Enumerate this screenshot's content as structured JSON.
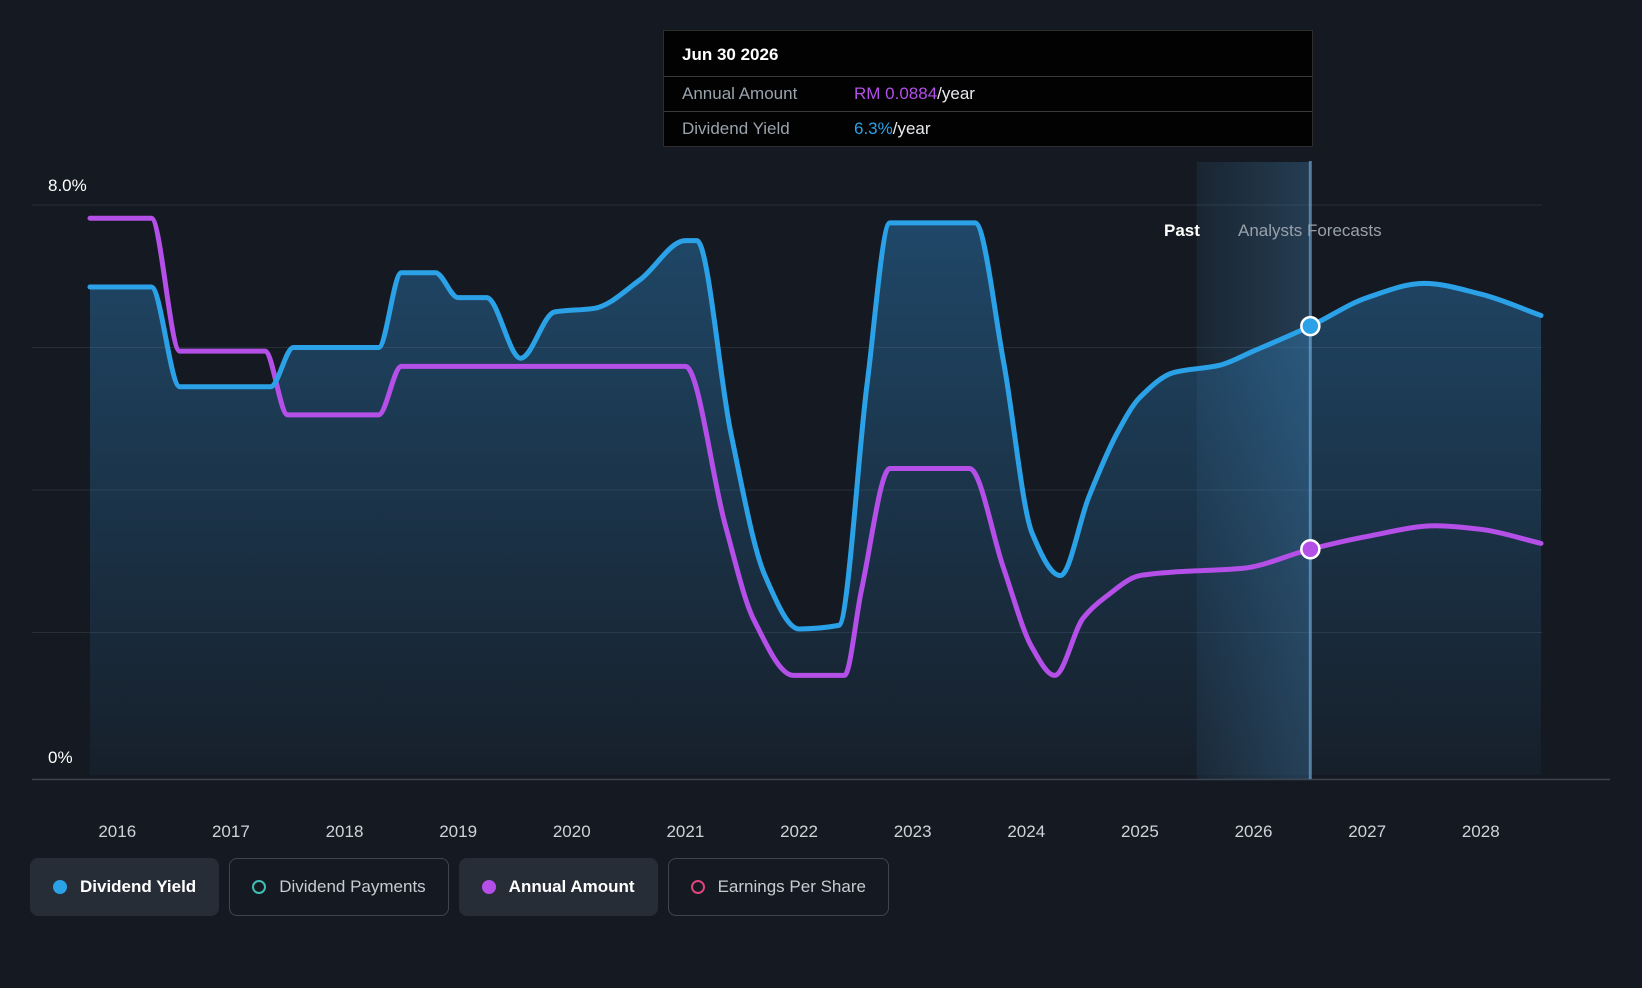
{
  "tooltip": {
    "date": "Jun 30 2026",
    "rows": [
      {
        "label": "Annual Amount",
        "value": "RM 0.0884",
        "suffix": "/year",
        "color": "#b44fe8"
      },
      {
        "label": "Dividend Yield",
        "value": "6.3%",
        "suffix": "/year",
        "color": "#2ba2e8"
      }
    ]
  },
  "legend": {
    "items": [
      {
        "label": "Dividend Yield",
        "color": "#2ba2e8",
        "marker": "filled",
        "active": true
      },
      {
        "label": "Dividend Payments",
        "color": "#3fbfb4",
        "marker": "outline",
        "active": false
      },
      {
        "label": "Annual Amount",
        "color": "#b44fe8",
        "marker": "filled",
        "active": true
      },
      {
        "label": "Earnings Per Share",
        "color": "#e0447e",
        "marker": "outline",
        "active": false
      }
    ]
  },
  "chart_data": {
    "type": "line",
    "x_unit": "year",
    "x_range": [
      2015.76,
      2028.53
    ],
    "x_ticks": [
      2016,
      2017,
      2018,
      2019,
      2020,
      2021,
      2022,
      2023,
      2024,
      2025,
      2026,
      2027,
      2028
    ],
    "axes": {
      "y_top": "8.0%",
      "y_bottom": "0%",
      "ylim_percent": [
        0,
        8
      ],
      "grid_percent": [
        0,
        2,
        4,
        6,
        8
      ]
    },
    "annotations": {
      "past_label": "Past",
      "forecast_label": "Analysts Forecasts",
      "forecast_start_x": 2025.5,
      "hover_x": 2026.5
    },
    "series": [
      {
        "name": "Dividend Yield",
        "color": "#2ba2e8",
        "unit": "%",
        "ylim": [
          0,
          8
        ],
        "area": true,
        "points": [
          [
            2015.76,
            6.85
          ],
          [
            2016.3,
            6.85
          ],
          [
            2016.55,
            5.45
          ],
          [
            2017.35,
            5.45
          ],
          [
            2017.55,
            6.0
          ],
          [
            2018.3,
            6.0
          ],
          [
            2018.5,
            7.05
          ],
          [
            2018.8,
            7.05
          ],
          [
            2019.0,
            6.7
          ],
          [
            2019.25,
            6.7
          ],
          [
            2019.55,
            5.85
          ],
          [
            2019.85,
            6.5
          ],
          [
            2020.2,
            6.55
          ],
          [
            2020.6,
            6.95
          ],
          [
            2021.0,
            7.5
          ],
          [
            2021.1,
            7.5
          ],
          [
            2021.4,
            4.8
          ],
          [
            2021.7,
            2.8
          ],
          [
            2022.0,
            2.05
          ],
          [
            2022.35,
            2.1
          ],
          [
            2022.6,
            5.5
          ],
          [
            2022.8,
            7.75
          ],
          [
            2023.55,
            7.75
          ],
          [
            2023.8,
            5.8
          ],
          [
            2024.05,
            3.4
          ],
          [
            2024.3,
            2.8
          ],
          [
            2024.55,
            3.9
          ],
          [
            2024.8,
            4.8
          ],
          [
            2025.0,
            5.3
          ],
          [
            2025.3,
            5.65
          ],
          [
            2025.7,
            5.75
          ],
          [
            2026.0,
            5.95
          ],
          [
            2026.5,
            6.3
          ],
          [
            2027.0,
            6.7
          ],
          [
            2027.5,
            6.9
          ],
          [
            2028.0,
            6.75
          ],
          [
            2028.53,
            6.45
          ]
        ]
      },
      {
        "name": "Annual Amount",
        "color": "#b44fe8",
        "unit": "RM/year",
        "ylim": [
          0,
          0.2232
        ],
        "area": false,
        "points": [
          [
            2015.76,
            0.218
          ],
          [
            2016.3,
            0.218
          ],
          [
            2016.55,
            0.166
          ],
          [
            2017.3,
            0.166
          ],
          [
            2017.5,
            0.141
          ],
          [
            2018.3,
            0.141
          ],
          [
            2018.5,
            0.16
          ],
          [
            2021.0,
            0.16
          ],
          [
            2021.35,
            0.098
          ],
          [
            2021.6,
            0.061
          ],
          [
            2021.95,
            0.039
          ],
          [
            2022.4,
            0.039
          ],
          [
            2022.55,
            0.0725
          ],
          [
            2022.8,
            0.12
          ],
          [
            2023.5,
            0.12
          ],
          [
            2023.8,
            0.081
          ],
          [
            2024.05,
            0.05
          ],
          [
            2024.25,
            0.039
          ],
          [
            2024.5,
            0.0614
          ],
          [
            2024.7,
            0.0698
          ],
          [
            2025.0,
            0.0781
          ],
          [
            2025.3,
            0.0795
          ],
          [
            2025.9,
            0.0809
          ],
          [
            2026.5,
            0.0884
          ],
          [
            2027.0,
            0.0934
          ],
          [
            2027.6,
            0.0976
          ],
          [
            2028.0,
            0.0962
          ],
          [
            2028.53,
            0.0907
          ]
        ]
      }
    ],
    "markers": [
      {
        "series": 0,
        "x": 2026.5,
        "value": 6.3
      },
      {
        "series": 1,
        "x": 2026.5,
        "value": 0.0884
      }
    ]
  }
}
